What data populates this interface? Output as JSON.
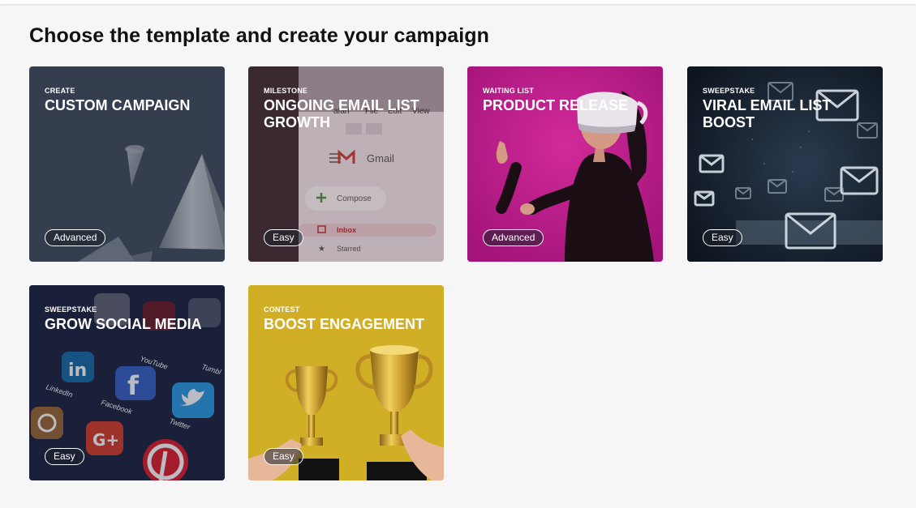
{
  "page": {
    "title": "Choose the template and create your campaign"
  },
  "templates": [
    {
      "kicker": "CREATE",
      "title": "CUSTOM CAMPAIGN",
      "difficulty": "Advanced"
    },
    {
      "kicker": "MILESTONE",
      "title": "ONGOING EMAIL LIST GROWTH",
      "difficulty": "Easy",
      "image_text": {
        "browser_menu": [
          "afari",
          "File",
          "Edit",
          "View"
        ],
        "app_name": "Gmail",
        "compose": "Compose",
        "inbox": "Inbox",
        "starred": "Starred"
      }
    },
    {
      "kicker": "WAITING LIST",
      "title": "PRODUCT RELEASE",
      "difficulty": "Advanced"
    },
    {
      "kicker": "SWEEPSTAKE",
      "title": "VIRAL EMAIL LIST BOOST",
      "difficulty": "Easy"
    },
    {
      "kicker": "SWEEPSTAKE",
      "title": "GROW SOCIAL MEDIA",
      "difficulty": "Easy",
      "image_text": [
        "YouTube",
        "LinkedIn",
        "Facebook",
        "Twitter",
        "Tumbl"
      ]
    },
    {
      "kicker": "CONTEST",
      "title": "BOOST ENGAGEMENT",
      "difficulty": "Easy"
    }
  ],
  "colors": {
    "background": "#f6f6f6",
    "custom_card": "#353e4e",
    "product_card": "#c21a8a",
    "engagement_card": "#d1b025",
    "badge_border": "#ffffff"
  }
}
